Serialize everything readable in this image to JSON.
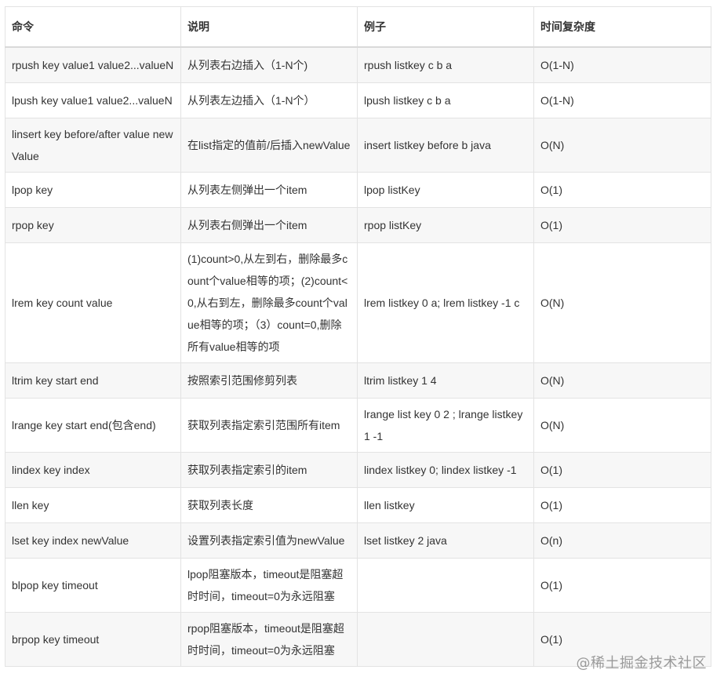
{
  "table": {
    "headers": [
      "命令",
      "说明",
      "例子",
      "时间复杂度"
    ],
    "rows": [
      [
        "rpush key value1 value2...valueN",
        "从列表右边插入（1-N个)",
        "rpush listkey c b a",
        "O(1-N)"
      ],
      [
        "lpush key value1 value2...valueN",
        "从列表左边插入（1-N个）",
        "lpush listkey c b a",
        "O(1-N)"
      ],
      [
        "linsert key before/after value newValue",
        "在list指定的值前/后插入newValue",
        "insert listkey before b java",
        "O(N)"
      ],
      [
        "lpop key",
        "从列表左侧弹出一个item",
        "lpop listKey",
        "O(1)"
      ],
      [
        "rpop key",
        "从列表右侧弹出一个item",
        "rpop listKey",
        "O(1)"
      ],
      [
        "lrem key count value",
        "(1)count>0,从左到右，删除最多count个value相等的项；(2)count<0,从右到左，删除最多count个value相等的项；（3）count=0,删除所有value相等的项",
        "lrem listkey 0 a; lrem listkey -1 c",
        "O(N)"
      ],
      [
        "ltrim key start end",
        "按照索引范围修剪列表",
        "ltrim listkey 1 4",
        "O(N)"
      ],
      [
        "lrange key start end(包含end)",
        "获取列表指定索引范围所有item",
        "lrange list key 0 2 ; lrange listkey 1 -1",
        "O(N)"
      ],
      [
        "lindex key index",
        "获取列表指定索引的item",
        "lindex listkey 0; lindex listkey -1",
        "O(1)"
      ],
      [
        "llen key",
        "获取列表长度",
        "llen listkey",
        "O(1)"
      ],
      [
        "lset key index newValue",
        "设置列表指定索引值为newValue",
        "lset listkey 2 java",
        "O(n)"
      ],
      [
        "blpop key timeout",
        "lpop阻塞版本，timeout是阻塞超时时间，timeout=0为永远阻塞",
        "",
        "O(1)"
      ],
      [
        "brpop key timeout",
        "rpop阻塞版本，timeout是阻塞超时时间，timeout=0为永远阻塞",
        "",
        "O(1)"
      ]
    ]
  },
  "watermark": "@稀土掘金技术社区"
}
